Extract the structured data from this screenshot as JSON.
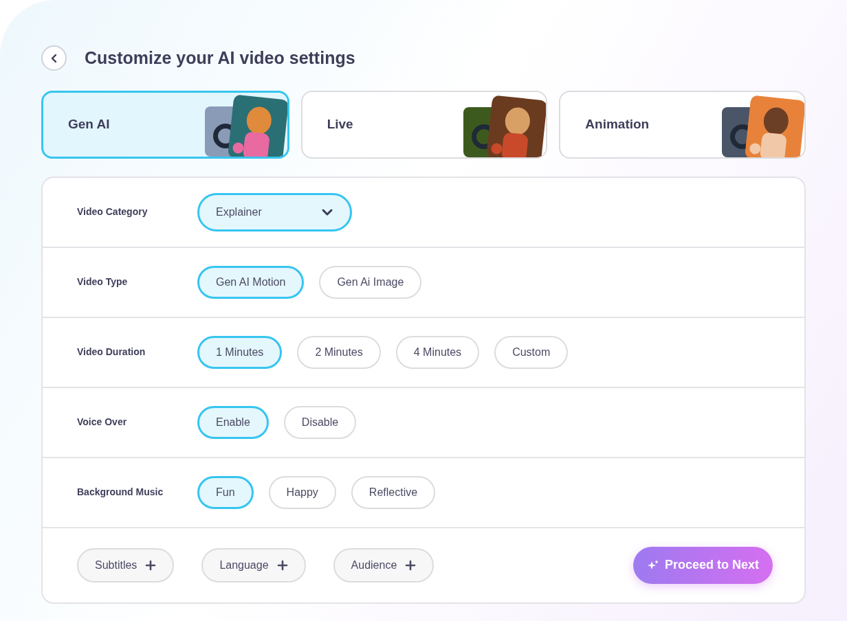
{
  "header": {
    "title": "Customize your AI video settings"
  },
  "modes": [
    {
      "label": "Gen AI",
      "selected": true,
      "kind": "genai"
    },
    {
      "label": "Live",
      "selected": false,
      "kind": "live"
    },
    {
      "label": "Animation",
      "selected": false,
      "kind": "animation"
    }
  ],
  "settings": [
    {
      "kind": "dropdown",
      "label": "Video Category",
      "value": "Explainer"
    },
    {
      "kind": "options",
      "label": "Video Type",
      "options": [
        {
          "label": "Gen AI Motion",
          "selected": true
        },
        {
          "label": "Gen Ai Image",
          "selected": false
        }
      ]
    },
    {
      "kind": "options",
      "label": "Video Duration",
      "options": [
        {
          "label": "1 Minutes",
          "selected": true
        },
        {
          "label": "2 Minutes",
          "selected": false
        },
        {
          "label": "4 Minutes",
          "selected": false
        },
        {
          "label": "Custom",
          "selected": false
        }
      ]
    },
    {
      "kind": "options",
      "label": "Voice Over",
      "options": [
        {
          "label": "Enable",
          "selected": true
        },
        {
          "label": "Disable",
          "selected": false
        }
      ]
    },
    {
      "kind": "options",
      "label": "Background Music",
      "options": [
        {
          "label": "Fun",
          "selected": true
        },
        {
          "label": "Happy",
          "selected": false
        },
        {
          "label": "Reflective",
          "selected": false
        }
      ]
    }
  ],
  "extras": [
    {
      "label": "Subtitles"
    },
    {
      "label": "Language"
    },
    {
      "label": "Audience"
    }
  ],
  "proceed_button": {
    "label": "Proceed to Next"
  }
}
